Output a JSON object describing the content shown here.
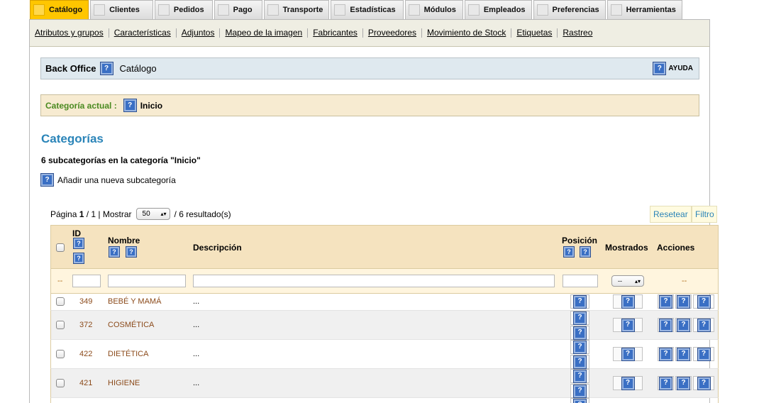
{
  "tabs": [
    {
      "label": "Catálogo",
      "active": true
    },
    {
      "label": "Clientes"
    },
    {
      "label": "Pedidos"
    },
    {
      "label": "Pago"
    },
    {
      "label": "Transporte"
    },
    {
      "label": "Estadísticas"
    },
    {
      "label": "Módulos"
    },
    {
      "label": "Empleados"
    },
    {
      "label": "Preferencias"
    },
    {
      "label": "Herramientas"
    }
  ],
  "subnav": [
    "Atributos y grupos",
    "Características",
    "Adjuntos",
    "Mapeo de la imagen",
    "Fabricantes",
    "Proveedores",
    "Movimiento de Stock",
    "Etiquetas",
    "Rastreo"
  ],
  "breadcrumb": {
    "root": "Back Office",
    "current": "Catálogo",
    "help": "AYUDA"
  },
  "current_category": {
    "label": "Categoría actual :",
    "value": "Inicio"
  },
  "section_title": "Categorías",
  "subcount": "6 subcategorías en la categoría \"Inicio\"",
  "add_label": "Añadir una nueva subcategoría",
  "pager": {
    "prefix": "Página",
    "page": "1",
    "of": "/ 1 | Mostrar",
    "per_page": "50",
    "results": "/ 6 resultado(s)"
  },
  "buttons": {
    "reset": "Resetear",
    "filter": "Filtro"
  },
  "columns": {
    "id": "ID",
    "name": "Nombre",
    "desc": "Descripción",
    "pos": "Posición",
    "shown": "Mostrados",
    "actions": "Acciones"
  },
  "filter": {
    "dash": "--",
    "shown_select": "--"
  },
  "rows": [
    {
      "id": "349",
      "name": "Bebé y mamá",
      "desc": "..."
    },
    {
      "id": "372",
      "name": "Cosmética",
      "desc": "..."
    },
    {
      "id": "422",
      "name": "Dietética",
      "desc": "..."
    },
    {
      "id": "421",
      "name": "Higiene",
      "desc": "..."
    }
  ],
  "q": "?"
}
